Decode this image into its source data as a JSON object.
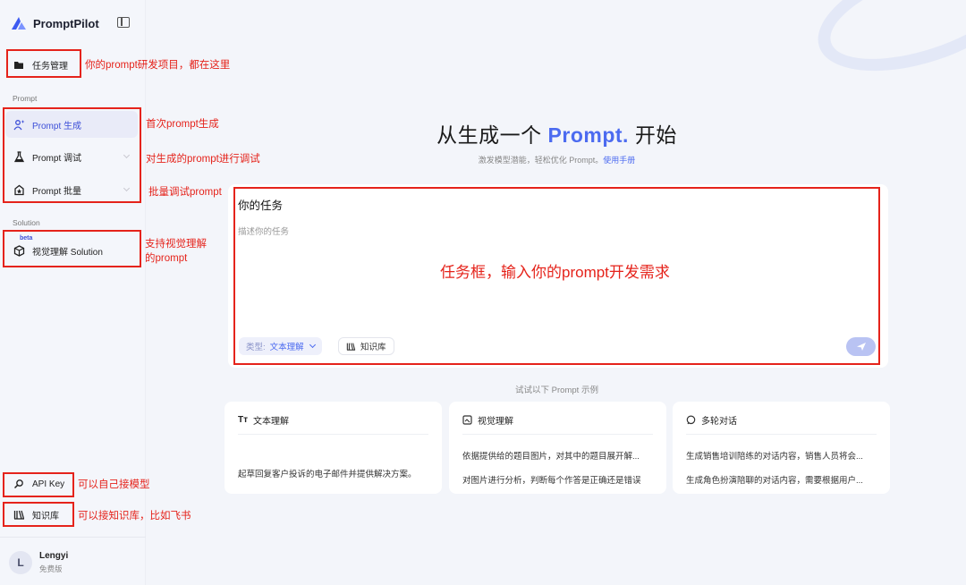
{
  "brand": {
    "name": "PromptPilot"
  },
  "sidebar": {
    "task_management": "任务管理",
    "section_prompt": "Prompt",
    "prompt_generate": "Prompt 生成",
    "prompt_debug": "Prompt 调试",
    "prompt_batch": "Prompt 批量",
    "section_solution": "Solution",
    "beta": "beta",
    "vision_solution": "视觉理解 Solution",
    "api_key": "API Key",
    "knowledge_base": "知识库"
  },
  "user": {
    "avatar_letter": "L",
    "name": "Lengyi",
    "plan": "免费版"
  },
  "hero": {
    "title_before": "从生成一个 ",
    "title_accent": "Prompt.",
    "title_after": " 开始",
    "subtitle": "激发模型潜能，轻松优化 Prompt。",
    "subtitle_link": "使用手册"
  },
  "task": {
    "label": "你的任务",
    "placeholder": "描述你的任务",
    "type_key": "类型:",
    "type_value": "文本理解",
    "knowledge_label": "知识库"
  },
  "examples": {
    "label": "试试以下 Prompt 示例",
    "cards": [
      {
        "title": "文本理解",
        "lines": [
          "起草回复客户投诉的电子邮件并提供解决方案。"
        ]
      },
      {
        "title": "视觉理解",
        "lines": [
          "依据提供给的题目图片，对其中的题目展开解...",
          "对图片进行分析，判断每个作答是正确还是错误"
        ]
      },
      {
        "title": "多轮对话",
        "lines": [
          "生成销售培训陪练的对话内容，销售人员将会...",
          "生成角色扮演陪聊的对话内容，需要根据用户..."
        ]
      }
    ]
  },
  "annotations": {
    "task_mgmt": "你的prompt研发项目，都在这里",
    "generate": "首次prompt生成",
    "debug": "对生成的prompt进行调试",
    "batch": "批量调试prompt",
    "vision_line1": "支持视觉理解",
    "vision_line2": "的prompt",
    "task_box": "任务框，输入你的prompt开发需求",
    "api_key": "可以自己接模型",
    "knowledge": "可以接知识库，比如飞书"
  },
  "colors": {
    "accent": "#4c6bf0",
    "annotation": "#e5231b"
  }
}
